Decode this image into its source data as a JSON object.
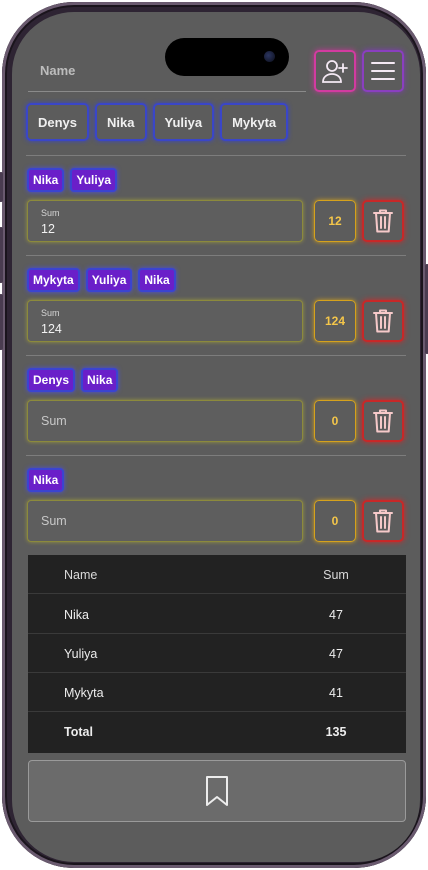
{
  "header": {
    "name_placeholder": "Name",
    "add_person_icon": "add-person-icon",
    "menu_icon": "hamburger-menu-icon"
  },
  "people": [
    "Denys",
    "Nika",
    "Yuliya",
    "Mykyta"
  ],
  "expenses": [
    {
      "participants": [
        "Nika",
        "Yuliya"
      ],
      "sum_label": "Sum",
      "sum_value": "12",
      "sum_placeholder": "",
      "count": "12"
    },
    {
      "participants": [
        "Mykyta",
        "Yuliya",
        "Nika"
      ],
      "sum_label": "Sum",
      "sum_value": "124",
      "sum_placeholder": "",
      "count": "124"
    },
    {
      "participants": [
        "Denys",
        "Nika"
      ],
      "sum_label": "",
      "sum_value": "",
      "sum_placeholder": "Sum",
      "count": "0"
    },
    {
      "participants": [
        "Nika"
      ],
      "sum_label": "",
      "sum_value": "",
      "sum_placeholder": "Sum",
      "count": "0"
    }
  ],
  "summary": {
    "headers": {
      "name": "Name",
      "sum": "Sum"
    },
    "rows": [
      {
        "name": "Nika",
        "sum": "47"
      },
      {
        "name": "Yuliya",
        "sum": "47"
      },
      {
        "name": "Mykyta",
        "sum": "41"
      }
    ],
    "total": {
      "name": "Total",
      "sum": "135"
    }
  },
  "footer": {
    "save_icon": "bookmark-icon"
  },
  "colors": {
    "tag_bg": "#6a1fc9",
    "tag_border": "#3b44d0",
    "count_border": "#d6a21c",
    "trash_border": "#c82828",
    "add_border": "#d23ba0",
    "menu_border": "#8a3fc0"
  }
}
